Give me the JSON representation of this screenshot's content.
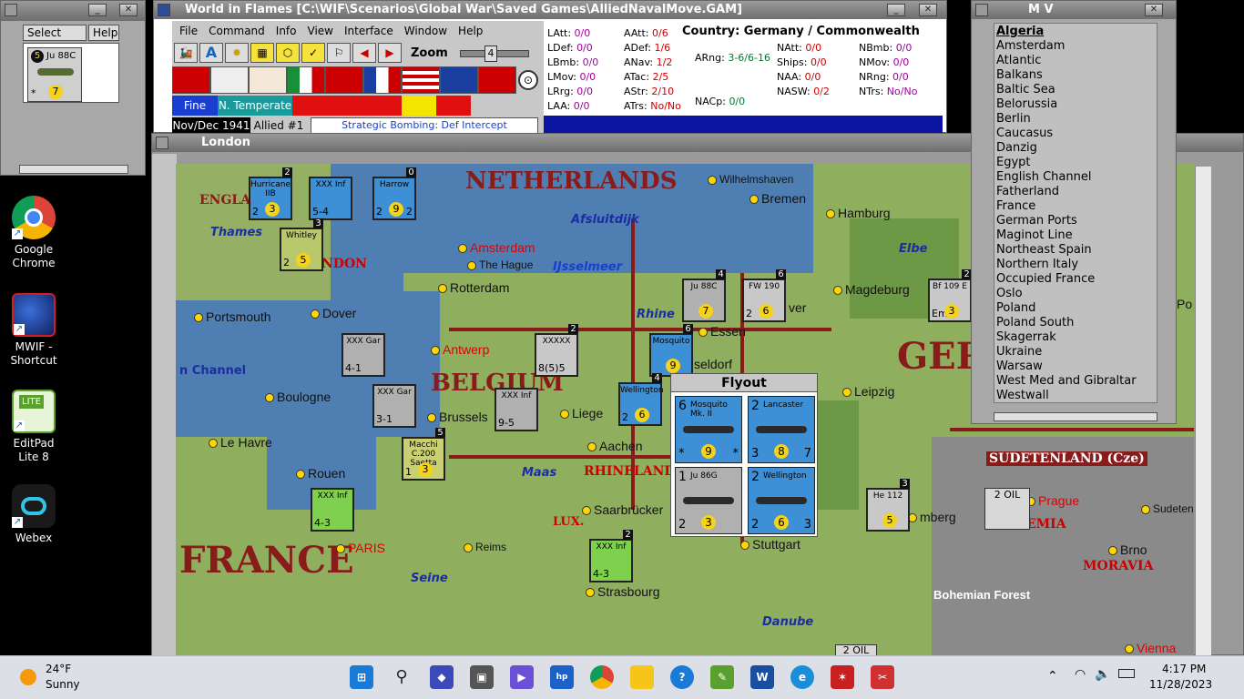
{
  "desktop": {
    "icons": [
      {
        "label": "Google Chrome"
      },
      {
        "label": "MWIF - Shortcut"
      },
      {
        "label": "EditPad Lite 8"
      },
      {
        "label": "Webex"
      }
    ]
  },
  "select_window": {
    "tabs": [
      "Select",
      "Help"
    ],
    "unit": {
      "name": "Ju 88C",
      "top_num": "5",
      "badge": "7",
      "footer": "*"
    }
  },
  "main_window": {
    "title": "World in Flames [C:\\WIF\\Scenarios\\Global War\\Saved Games\\AlliedNavalMove.GAM]",
    "menu": [
      "File",
      "Command",
      "Info",
      "View",
      "Interface",
      "Window",
      "Help"
    ],
    "zoom_label": "Zoom",
    "zoom_value": "4",
    "weather": "Fine",
    "zone": "N. Temperate",
    "date": "Nov/Dec 1941",
    "impulse": "Allied #1",
    "phase": "Strategic Bombing: Def Intercept",
    "country": "Country: Germany / Commonwealth",
    "stats_col1": [
      {
        "k": "LAtt:",
        "v": "0/0"
      },
      {
        "k": "LDef:",
        "v": "0/0"
      },
      {
        "k": "LBmb:",
        "v": "0/0"
      },
      {
        "k": "LMov:",
        "v": "0/0"
      },
      {
        "k": "LRrg:",
        "v": "0/0"
      },
      {
        "k": "LAA:",
        "v": "0/0"
      }
    ],
    "stats_col2": [
      {
        "k": "AAtt:",
        "v": "0/6"
      },
      {
        "k": "ADef:",
        "v": "1/6"
      },
      {
        "k": "ANav:",
        "v": "1/2"
      },
      {
        "k": "ATac:",
        "v": "2/5"
      },
      {
        "k": "AStr:",
        "v": "2/10"
      },
      {
        "k": "ATrs:",
        "v": "No/No"
      }
    ],
    "stats_col3": [
      {
        "k": "NAtt:",
        "v": "0/0"
      },
      {
        "k": "Ships:",
        "v": "0/0"
      },
      {
        "k": "NAA:",
        "v": "0/0"
      },
      {
        "k": "NASW:",
        "v": "0/2"
      }
    ],
    "stats_col4": [
      {
        "k": "NBmb:",
        "v": "0/0"
      },
      {
        "k": "NMov:",
        "v": "0/0"
      },
      {
        "k": "NRng:",
        "v": "0/0"
      },
      {
        "k": "NTrs:",
        "v": "No/No"
      }
    ],
    "arng": {
      "k": "ARng:",
      "v": "3-6/6-16"
    },
    "nacp": {
      "k": "NACp:",
      "v": "0/0"
    }
  },
  "mv_window": {
    "title": "M V",
    "items": [
      "Algeria",
      "Amsterdam",
      "Atlantic",
      "Balkans",
      "Baltic Sea",
      "Belorussia",
      "Berlin",
      "Caucasus",
      "Danzig",
      "Egypt",
      "English Channel",
      "Fatherland",
      "France",
      "German Ports",
      "Maginot Line",
      "Northeast Spain",
      "Northern Italy",
      "Occupied France",
      "Oslo",
      "Poland",
      "Poland South",
      "Skagerrak",
      "Ukraine",
      "Warsaw",
      "West Med and Gibraltar",
      "Westwall"
    ],
    "selected": "Algeria"
  },
  "map_window": {
    "title": "London",
    "regions": [
      "NETHERLANDS",
      "BELGIUM",
      "GER",
      "FRANCE"
    ],
    "subregions": [
      "ENGLA",
      "NDON",
      "RHINELAND",
      "LUX.",
      "SUDETENLAND (Cze)",
      "MORAVIA",
      "EMIA",
      "Bohemian Forest"
    ],
    "cities": [
      "Amsterdam",
      "The Hague",
      "Rotterdam",
      "Antwerp",
      "Brussels",
      "Liege",
      "Aachen",
      "Essen",
      "Bremen",
      "Hamburg",
      "Magdeburg",
      "Leipzig",
      "Portsmouth",
      "Dover",
      "Boulogne",
      "Le Havre",
      "Rouen",
      "Reims",
      "Saarbrücker",
      "Strasbourg",
      "Stuttgart",
      "Prague",
      "Brno",
      "Sudeten",
      "Wilhelmshaven",
      "PARIS",
      "seldorf",
      "ver",
      "mberg",
      "Vienna",
      "Po"
    ],
    "waters": [
      "Thames",
      "Afsluitdijk",
      "IJsselmeer",
      "Rhine",
      "Elbe",
      "Maas",
      "Seine",
      "Danube",
      "n Channel"
    ],
    "resources": [
      "2 OIL",
      "2 OIL"
    ],
    "counters": [
      {
        "name": "Hurricane IIB",
        "l": "2",
        "r": "",
        "badge": "3",
        "top": "2"
      },
      {
        "name": "XXX Inf",
        "l": "5-4",
        "r": "",
        "badge": "",
        "top": ""
      },
      {
        "name": "Harrow",
        "l": "2",
        "r": "2",
        "badge": "9",
        "top": "0"
      },
      {
        "name": "Whitley",
        "l": "2",
        "r": "",
        "badge": "5",
        "top": "3"
      },
      {
        "name": "Ju 88C",
        "l": "",
        "r": "",
        "badge": "7",
        "top": "4"
      },
      {
        "name": "FW 190",
        "l": "2",
        "r": "",
        "badge": "6",
        "top": "6"
      },
      {
        "name": "Bf 109 E",
        "l": "Emil",
        "r": "",
        "badge": "3",
        "top": "2"
      },
      {
        "name": "Mosquito",
        "l": "",
        "r": "",
        "badge": "9",
        "top": "6"
      },
      {
        "name": "XXX Gar",
        "l": "4-1",
        "r": "",
        "badge": "",
        "top": ""
      },
      {
        "name": "XXXXX",
        "l": "8(5)5",
        "r": "",
        "badge": "",
        "top": "2"
      },
      {
        "name": "XXX Gar",
        "l": "3-1",
        "r": "",
        "badge": "",
        "top": ""
      },
      {
        "name": "XXX Inf",
        "l": "9-5",
        "r": "",
        "badge": "",
        "top": ""
      },
      {
        "name": "Wellington",
        "l": "2",
        "r": "",
        "badge": "6",
        "top": "4"
      },
      {
        "name": "Macchi C.200 Saetta",
        "l": "1",
        "r": "",
        "badge": "3",
        "top": "5"
      },
      {
        "name": "XXX Inf",
        "l": "4-3",
        "r": "",
        "badge": "",
        "top": ""
      },
      {
        "name": "XXX Inf",
        "l": "4-3",
        "r": "",
        "badge": "",
        "top": "2"
      },
      {
        "name": "He 112",
        "l": "",
        "r": "",
        "badge": "5",
        "top": "3"
      }
    ]
  },
  "flyout": {
    "title": "Flyout",
    "units": [
      {
        "name": "Mosquito Mk. II",
        "top_left": "6",
        "badge": "9",
        "bottom": "*",
        "bottom_right": "*",
        "color": "#3d8fd6"
      },
      {
        "name": "Lancaster",
        "top_left": "2",
        "badge": "8",
        "bottom": "3",
        "bottom_right": "7",
        "color": "#3d8fd6"
      },
      {
        "name": "Ju 86G",
        "top_left": "1",
        "badge": "3",
        "bottom": "2",
        "bottom_right": "",
        "color": "#b0b0b0"
      },
      {
        "name": "Wellington",
        "top_left": "2",
        "badge": "6",
        "bottom": "2",
        "bottom_right": "3",
        "color": "#3d8fd6"
      }
    ]
  },
  "taskbar": {
    "weather_temp": "24°F",
    "weather_desc": "Sunny",
    "time": "4:17 PM",
    "date": "11/28/2023",
    "apps": [
      "start",
      "search",
      "beta-app",
      "task-view",
      "meet",
      "myhp",
      "chrome",
      "explorer",
      "help",
      "editpad",
      "word",
      "edge",
      "mwif",
      "snip"
    ]
  },
  "colors": {
    "accent": "#1565c0",
    "border": "#8a1b1b",
    "sea": "#4f7fb2",
    "land": "#8fae5e"
  }
}
